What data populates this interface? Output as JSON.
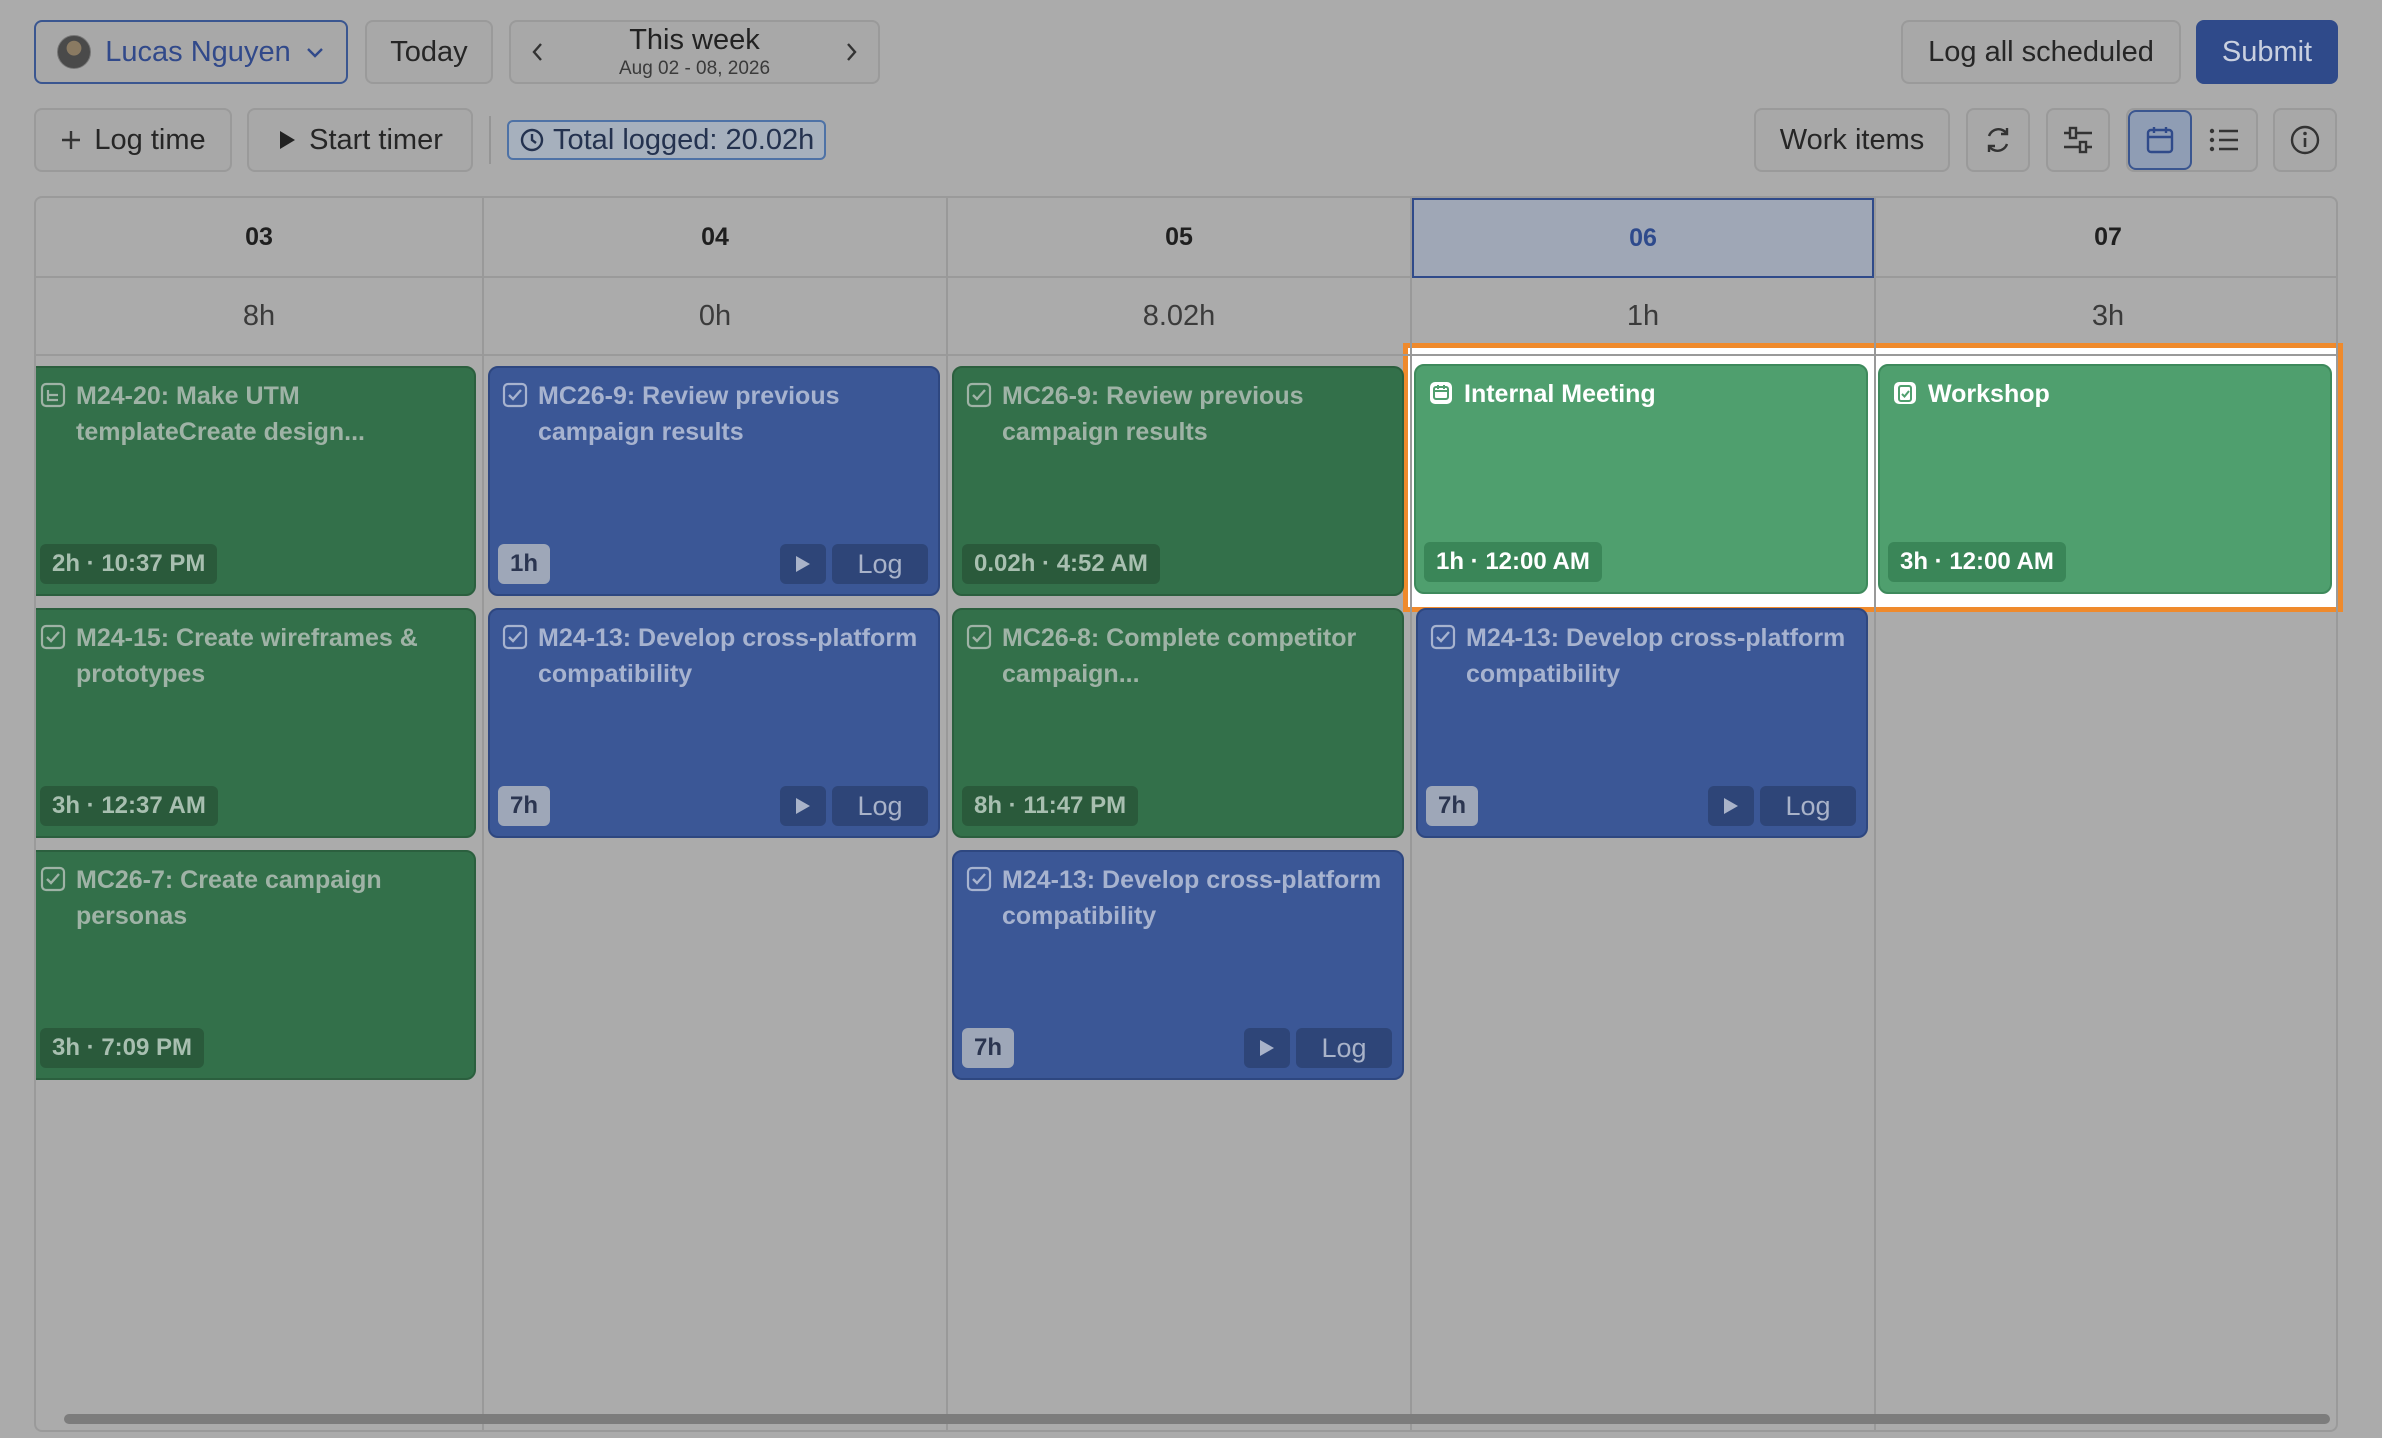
{
  "header": {
    "user_name": "Lucas Nguyen",
    "today_label": "Today",
    "week_title": "This week",
    "week_range": "Aug 02 - 08, 2026",
    "log_all_label": "Log all scheduled",
    "submit_label": "Submit"
  },
  "toolbar": {
    "log_time_label": "Log time",
    "start_timer_label": "Start timer",
    "total_logged": "Total logged: 20.02h",
    "work_items_label": "Work items"
  },
  "days": [
    {
      "day": "03",
      "total": "8h"
    },
    {
      "day": "04",
      "total": "0h"
    },
    {
      "day": "05",
      "total": "8.02h"
    },
    {
      "day": "06",
      "total": "1h"
    },
    {
      "day": "07",
      "total": "3h"
    }
  ],
  "current_day": "06",
  "cards": {
    "d03_1": {
      "title": "M24-20: Make UTM templateCreate design...",
      "meta": "2h · 10:37 PM"
    },
    "d03_2": {
      "title": "M24-15: Create wireframes & prototypes",
      "meta": "3h · 12:37 AM"
    },
    "d03_3": {
      "title": "MC26-7: Create campaign personas",
      "meta": "3h · 7:09 PM"
    },
    "d04_1": {
      "title": "MC26-9: Review previous campaign results",
      "meta": "1h",
      "action": "Log"
    },
    "d04_2": {
      "title": "M24-13: Develop cross-platform compatibility",
      "meta": "7h",
      "action": "Log"
    },
    "d05_1": {
      "title": "MC26-9: Review previous campaign results",
      "meta": "0.02h · 4:52 AM"
    },
    "d05_2": {
      "title": "MC26-8: Complete competitor campaign...",
      "meta": "8h · 11:47 PM"
    },
    "d05_3": {
      "title": "M24-13: Develop cross-platform compatibility",
      "meta": "7h",
      "action": "Log"
    },
    "d06_1": {
      "title": "Internal Meeting",
      "meta": "1h · 12:00 AM"
    },
    "d06_2": {
      "title": "M24-13: Develop cross-platform compatibility",
      "meta": "7h",
      "action": "Log"
    },
    "d07_1": {
      "title": "Workshop",
      "meta": "3h · 12:00 AM"
    }
  },
  "colors": {
    "accent": "#2f4a8a",
    "highlight": "#ef8a2c",
    "logged_card": "#33704a",
    "scheduled_card": "#3b5796",
    "selected_card": "#4f9f6e"
  }
}
